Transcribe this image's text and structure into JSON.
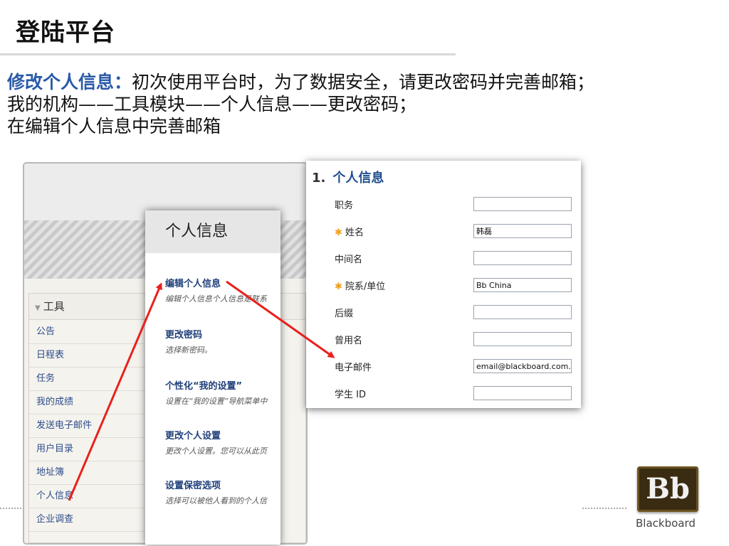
{
  "slide": {
    "title": "登陆平台",
    "intro_lead": "修改个人信息：",
    "intro_line1": "初次使用平台时，为了数据安全，请更改密码并完善邮箱；",
    "intro_line2": "我的机构——工具模块——个人信息——更改密码；",
    "intro_line3": "在编辑个人信息中完善邮箱"
  },
  "tools_panel": {
    "header": "工具",
    "items": [
      "公告",
      "日程表",
      "任务",
      "我的成绩",
      "发送电子邮件",
      "用户目录",
      "地址簿",
      "个人信息",
      "企业调查"
    ]
  },
  "popup": {
    "title": "个人信息",
    "items": [
      {
        "title": "编辑个人信息",
        "desc": "编辑个人信息个人信息是联系"
      },
      {
        "title": "更改密码",
        "desc": "选择新密码。"
      },
      {
        "title": "个性化“我的设置”",
        "desc": "设置在“我的设置”导航菜单中"
      },
      {
        "title": "更改个人设置",
        "desc": "更改个人设置。您可以从此页"
      },
      {
        "title": "设置保密选项",
        "desc": "选择可以被他人看到的个人信"
      }
    ]
  },
  "form": {
    "number": "1.",
    "title": "个人信息",
    "fields": [
      {
        "label": "职务",
        "required": false,
        "value": ""
      },
      {
        "label": "姓名",
        "required": true,
        "value": "韩磊"
      },
      {
        "label": "中间名",
        "required": false,
        "value": ""
      },
      {
        "label": "院系/单位",
        "required": true,
        "value": "Bb China"
      },
      {
        "label": "后缀",
        "required": false,
        "value": ""
      },
      {
        "label": "曾用名",
        "required": false,
        "value": ""
      },
      {
        "label": "电子邮件",
        "required": false,
        "value": "email@blackboard.com.cn"
      },
      {
        "label": "学生 ID",
        "required": false,
        "value": ""
      }
    ],
    "required_marker": "✱"
  },
  "logo": {
    "letters": "Bb",
    "name": "Blackboard"
  },
  "colors": {
    "accent_blue": "#2a5aa8",
    "arrow_red": "#e8211d",
    "required_orange": "#f0a020"
  }
}
